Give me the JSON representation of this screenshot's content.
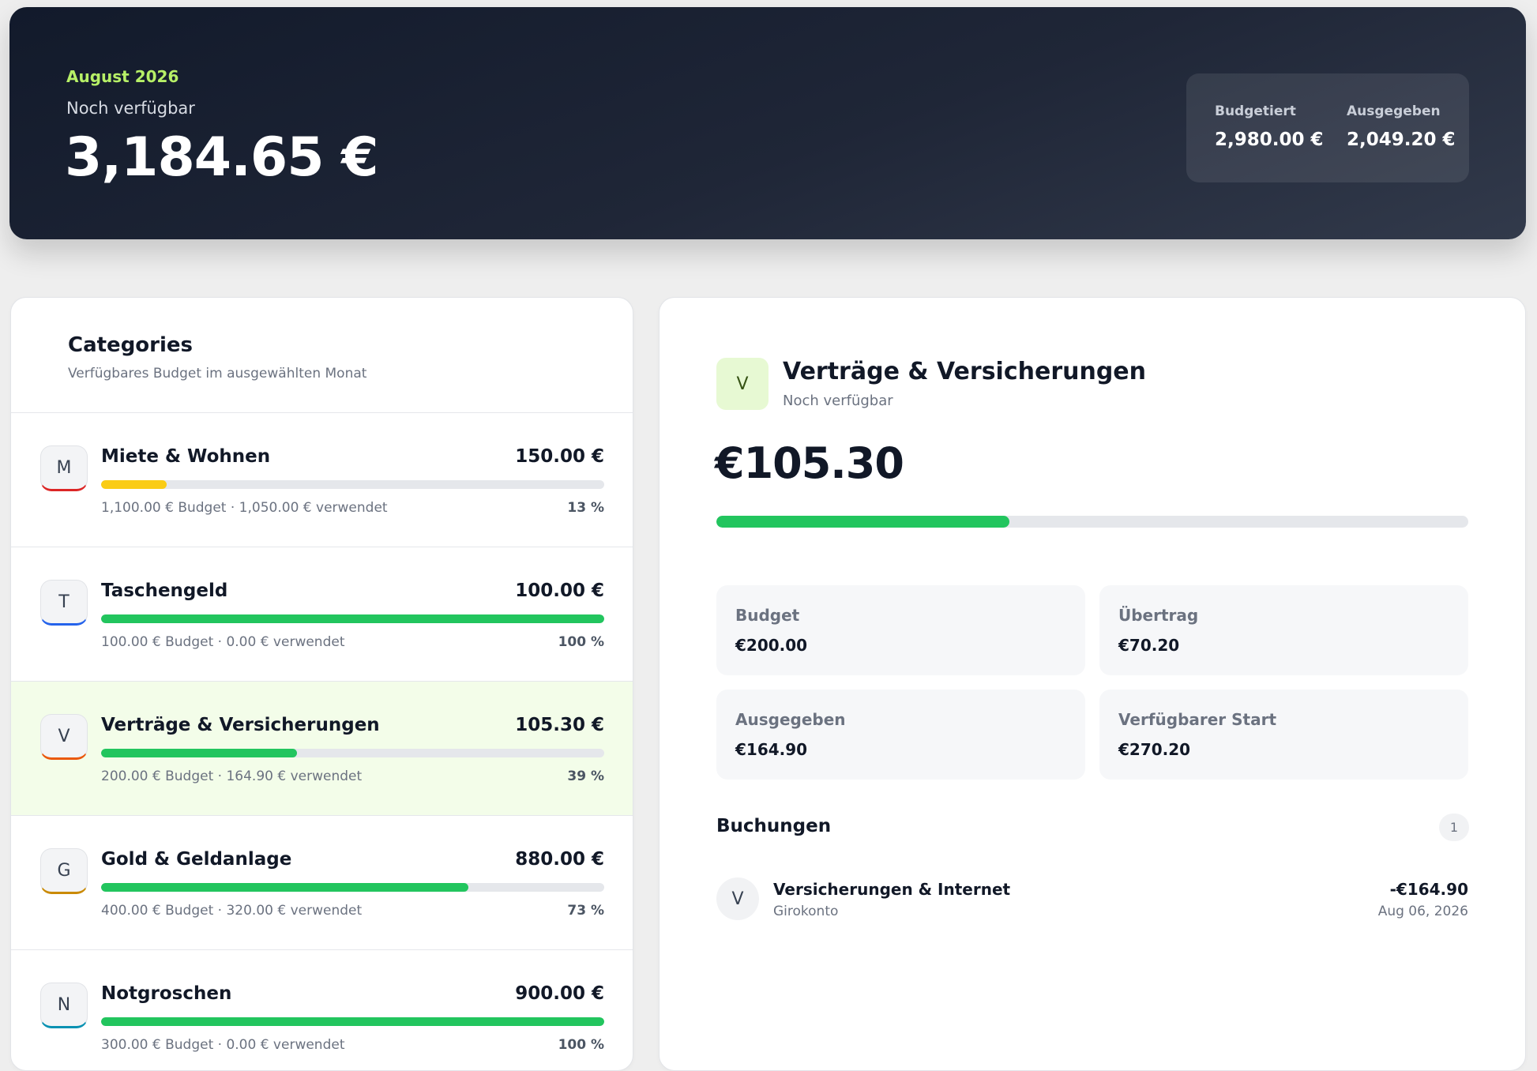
{
  "hero": {
    "month": "August 2026",
    "label": "Noch verfügbar",
    "amount": "3,184.65 €",
    "stats": [
      {
        "label": "Budgetiert",
        "value": "2,980.00 €"
      },
      {
        "label": "Ausgegeben",
        "value": "2,049.20 €"
      }
    ]
  },
  "categories": {
    "title": "Categories",
    "subtitle": "Verfügbares Budget im ausgewählten Monat",
    "items": [
      {
        "initial": "M",
        "name": "Miete & Wohnen",
        "amount": "150.00 €",
        "meta": "1,100.00 € Budget · 1,050.00 € verwendet",
        "pct": "13 %",
        "progress": 0.13,
        "bar_color": "#facc15",
        "accent": "#dc2626",
        "selected": false
      },
      {
        "initial": "T",
        "name": "Taschengeld",
        "amount": "100.00 €",
        "meta": "100.00 € Budget · 0.00 € verwendet",
        "pct": "100 %",
        "progress": 1.0,
        "bar_color": "#22c55e",
        "accent": "#2563eb",
        "selected": false
      },
      {
        "initial": "V",
        "name": "Verträge & Versicherungen",
        "amount": "105.30 €",
        "meta": "200.00 € Budget · 164.90 € verwendet",
        "pct": "39 %",
        "progress": 0.39,
        "bar_color": "#22c55e",
        "accent": "#ea580c",
        "selected": true
      },
      {
        "initial": "G",
        "name": "Gold & Geldanlage",
        "amount": "880.00 €",
        "meta": "400.00 € Budget · 320.00 € verwendet",
        "pct": "73 %",
        "progress": 0.73,
        "bar_color": "#22c55e",
        "accent": "#ca8a04",
        "selected": false
      },
      {
        "initial": "N",
        "name": "Notgroschen",
        "amount": "900.00 €",
        "meta": "300.00 € Budget · 0.00 € verwendet",
        "pct": "100 %",
        "progress": 1.0,
        "bar_color": "#22c55e",
        "accent": "#0891b2",
        "selected": false
      }
    ]
  },
  "detail": {
    "initial": "V",
    "title": "Verträge & Versicherungen",
    "subtitle": "Noch verfügbar",
    "amount": "€105.30",
    "progress": 0.39,
    "stats": [
      {
        "label": "Budget",
        "value": "€200.00"
      },
      {
        "label": "Übertrag",
        "value": "€70.20"
      },
      {
        "label": "Ausgegeben",
        "value": "€164.90"
      },
      {
        "label": "Verfügbarer Start",
        "value": "€270.20"
      }
    ],
    "bookings_title": "Buchungen",
    "bookings_count": "1",
    "transactions": [
      {
        "initial": "V",
        "name": "Versicherungen & Internet",
        "account": "Girokonto",
        "amount": "-€164.90",
        "date": "Aug 06, 2026"
      }
    ]
  }
}
